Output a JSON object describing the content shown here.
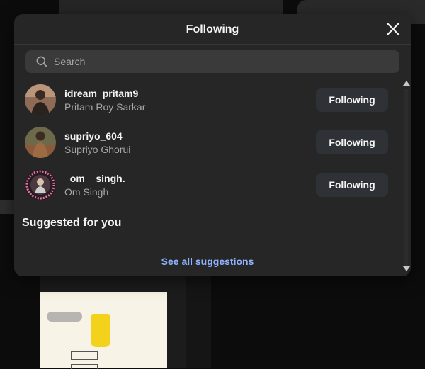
{
  "dialog": {
    "title": "Following",
    "close_icon": "close-icon"
  },
  "search": {
    "placeholder": "Search",
    "value": "",
    "icon": "search-icon"
  },
  "following": [
    {
      "username": "idream_pritam9",
      "full_name": "Pritam Roy Sarkar",
      "button_label": "Following"
    },
    {
      "username": "supriyo_604",
      "full_name": "Supriyo Ghorui",
      "button_label": "Following"
    },
    {
      "username": "_om__singh._",
      "full_name": "Om Singh",
      "button_label": "Following"
    }
  ],
  "suggested": {
    "heading": "Suggested for you",
    "see_all_label": "See all suggestions"
  },
  "colors": {
    "dialog_bg": "#262626",
    "button_bg": "#2e3136",
    "link": "#8fb3ff",
    "secondary_text": "#a8a8a8"
  }
}
